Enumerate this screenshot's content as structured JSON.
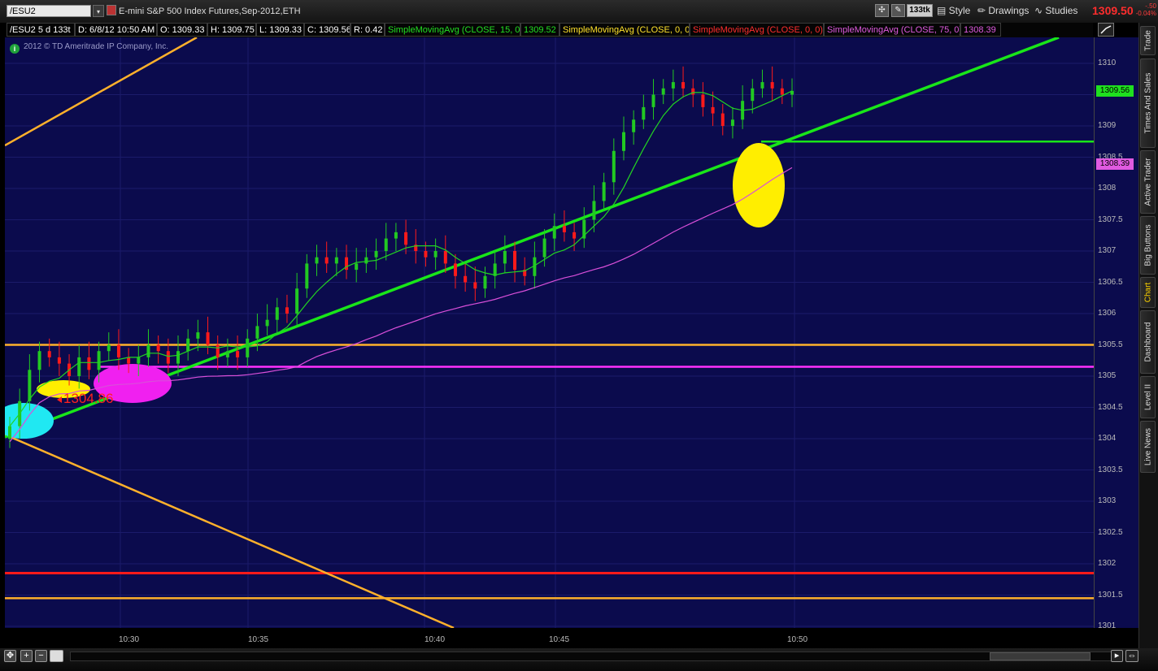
{
  "header": {
    "symbol": "/ESU2",
    "description": "E-mini S&P 500 Index Futures,Sep-2012,ETH",
    "aggregation": "133tk",
    "style_label": "Style",
    "drawings_label": "Drawings",
    "studies_label": "Studies",
    "last_price": "1309.50",
    "change": "-.50",
    "change_pct": "-0.04%"
  },
  "info": {
    "period": "/ESU2 5 d 133t",
    "date": "D: 6/8/12 10:50 AM",
    "open": "O: 1309.33",
    "high": "H: 1309.75",
    "low": "L: 1309.33",
    "close": "C: 1309.56",
    "range": "R: 0.42",
    "sma15": "SimpleMovingAvg (CLOSE, 15, 0)",
    "sma15_val": "1309.52",
    "sma_y": "SimpleMovingAvg (CLOSE, 0, 0)",
    "sma_r": "SimpleMovingAvg (CLOSE, 0, 0)",
    "sma75": "SimpleMovingAvg (CLOSE, 75, 0)",
    "sma75_val": "1308.39"
  },
  "copyright": "2012 © TD Ameritrade IP Company, Inc.",
  "annotation": "1304.86",
  "y_axis": {
    "min": 1301,
    "max": 1310.5,
    "ticks": [
      "1310",
      "1309.5",
      "1309",
      "1308.5",
      "1308",
      "1307.5",
      "1307",
      "1306.5",
      "1306",
      "1305.5",
      "1305",
      "1304.5",
      "1304",
      "1303.5",
      "1303",
      "1302.5",
      "1302",
      "1301.5",
      "1301"
    ],
    "tick_values": [
      1310,
      1309.5,
      1309,
      1308.5,
      1308,
      1307.5,
      1307,
      1306.5,
      1306,
      1305.5,
      1305,
      1304.5,
      1304,
      1303.5,
      1303,
      1302.5,
      1302,
      1301.5,
      1301
    ]
  },
  "price_tags": {
    "last": "1309.56",
    "sma75": "1308.39"
  },
  "x_axis": {
    "labels": [
      "10:30",
      "10:35",
      "10:40",
      "10:45",
      "10:50"
    ]
  },
  "side_tabs": [
    "Trade",
    "Times And Sales",
    "Active Trader",
    "Big Buttons",
    "Chart",
    "Dashboard",
    "Level II",
    "Live News"
  ],
  "active_tab": "Chart",
  "colors": {
    "background": "#0b0b4d",
    "up": "#22c922",
    "down": "#ff1a1a",
    "sma15": "#22d422",
    "sma75": "#d94fd9",
    "trend_green": "#19e619",
    "trend_orange": "#ffb12b",
    "level_red": "#ff1a1a"
  },
  "chart_data": {
    "type": "candlestick",
    "title": "",
    "ylim": [
      1301,
      1310.5
    ],
    "x_time_labels": [
      "10:30",
      "10:35",
      "10:40",
      "10:45",
      "10:50"
    ],
    "closes": [
      1304.2,
      1304.6,
      1305.1,
      1305.4,
      1305.3,
      1305.2,
      1305.0,
      1305.3,
      1305.1,
      1305.4,
      1305.5,
      1305.3,
      1305.2,
      1305.3,
      1305.5,
      1305.4,
      1305.2,
      1305.4,
      1305.6,
      1305.7,
      1305.5,
      1305.3,
      1305.4,
      1305.3,
      1305.6,
      1305.8,
      1305.9,
      1306.1,
      1306.0,
      1306.4,
      1306.8,
      1306.9,
      1306.8,
      1306.9,
      1306.7,
      1306.8,
      1306.9,
      1307.0,
      1307.2,
      1307.3,
      1307.1,
      1307.0,
      1306.9,
      1307.0,
      1306.8,
      1306.6,
      1306.5,
      1306.4,
      1306.6,
      1306.8,
      1307.0,
      1306.7,
      1306.6,
      1306.9,
      1307.2,
      1307.4,
      1307.3,
      1307.2,
      1307.5,
      1307.8,
      1308.1,
      1308.6,
      1308.9,
      1309.1,
      1309.3,
      1309.5,
      1309.6,
      1309.7,
      1309.6,
      1309.5,
      1309.3,
      1309.2,
      1309.0,
      1309.1,
      1309.4,
      1309.6,
      1309.7,
      1309.6,
      1309.5,
      1309.56
    ],
    "sma15_last": 1309.52,
    "sma75_last": 1308.39,
    "horizontal_levels": [
      {
        "value": 1305.5,
        "color": "orange"
      },
      {
        "value": 1305.15,
        "color": "magenta"
      },
      {
        "value": 1308.75,
        "color": "green"
      },
      {
        "value": 1301.85,
        "color": "red"
      },
      {
        "value": 1301.45,
        "color": "orange"
      }
    ],
    "annotations": [
      {
        "label": "1304.86"
      }
    ]
  }
}
